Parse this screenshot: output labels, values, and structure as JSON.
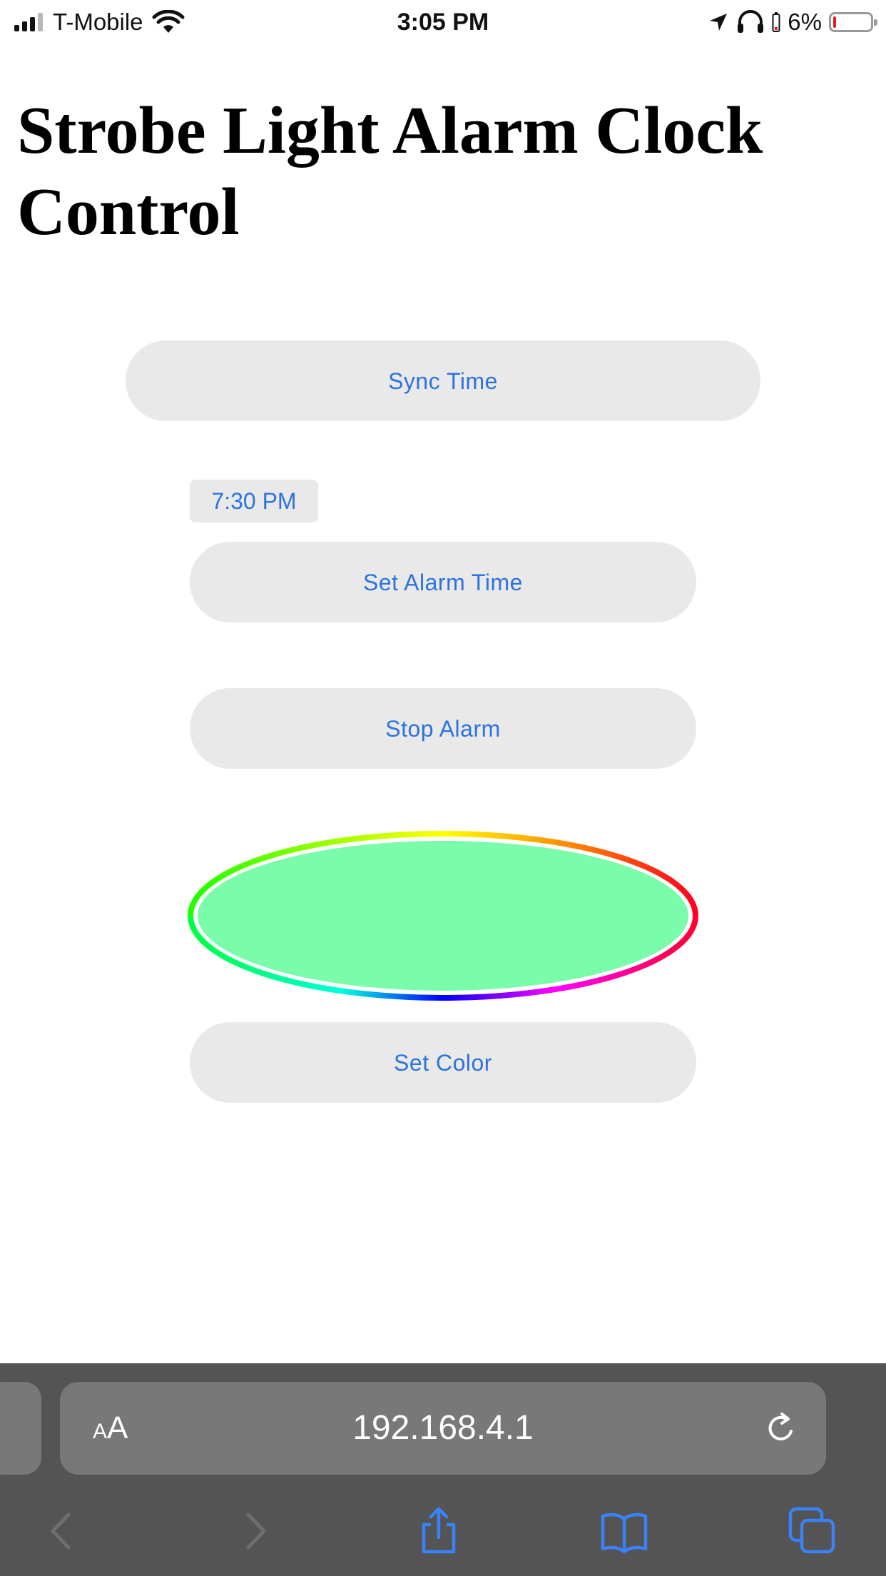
{
  "status_bar": {
    "carrier": "T-Mobile",
    "time": "3:05 PM",
    "battery_percent": "6%",
    "battery_level": 0.06,
    "icons": [
      "signal-icon",
      "wifi-icon",
      "location-arrow-icon",
      "headphones-icon",
      "battery-icon"
    ]
  },
  "page": {
    "title": "Strobe Light Alarm Clock Control"
  },
  "controls": {
    "sync_time_label": "Sync Time",
    "alarm_time_value": "7:30 PM",
    "set_alarm_label": "Set Alarm Time",
    "stop_alarm_label": "Stop Alarm",
    "selected_color": "#7afcab",
    "set_color_label": "Set Color"
  },
  "browser": {
    "text_size_small": "A",
    "text_size_big": "A",
    "url": "192.168.4.1",
    "toolbar_icons": [
      "back-icon",
      "forward-icon",
      "share-icon",
      "bookmarks-icon",
      "tabs-icon"
    ]
  },
  "colors": {
    "accent": "#2e73dd",
    "button_bg": "#e9e9ea",
    "browser_bar": "#545454",
    "url_field": "#787878"
  }
}
